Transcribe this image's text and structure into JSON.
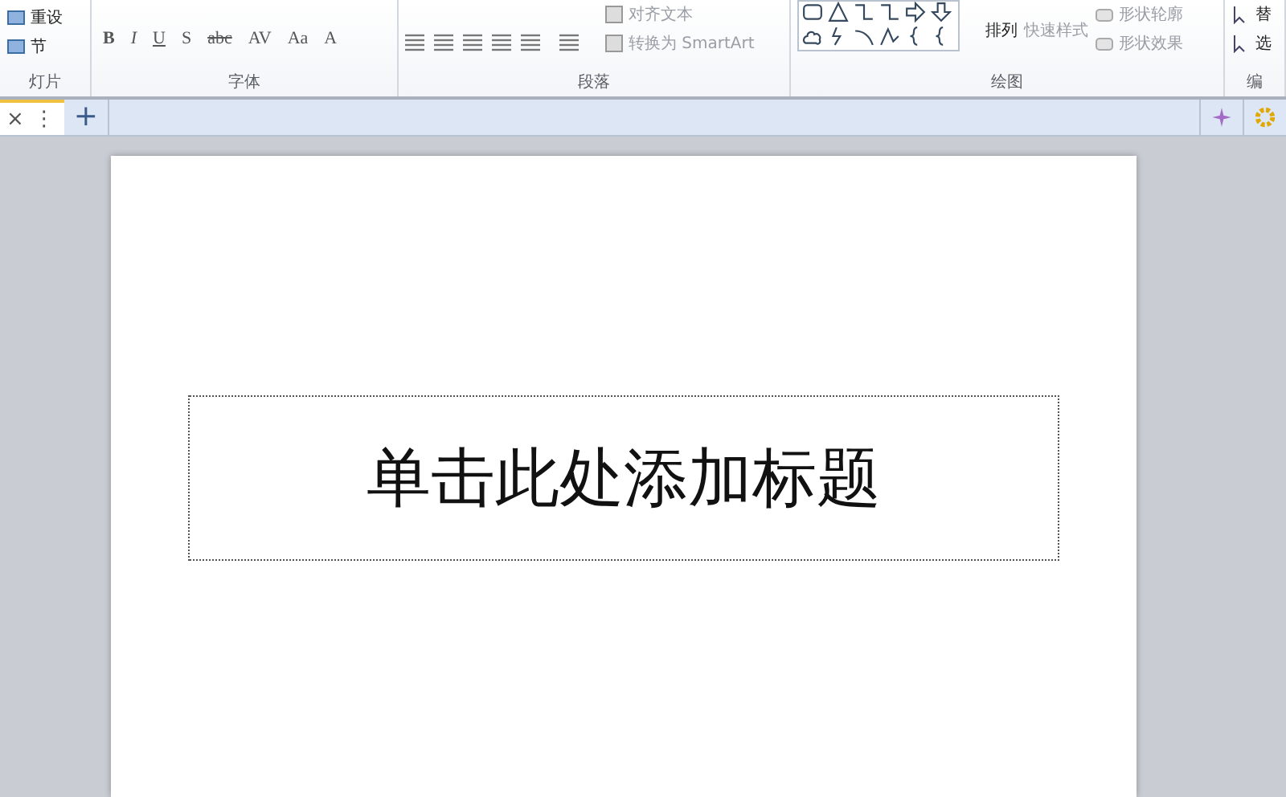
{
  "ribbon": {
    "groups": [
      {
        "kind": "slides",
        "label": "灯片",
        "items": [
          "重设",
          "节"
        ]
      },
      {
        "kind": "font",
        "label": "字体",
        "buttons": [
          "B",
          "I",
          "U",
          "S",
          "abc",
          "AV",
          "Aa",
          "A"
        ]
      },
      {
        "kind": "paragraph",
        "label": "段落",
        "items": [
          "对齐文本",
          "转换为 SmartArt"
        ]
      },
      {
        "kind": "drawing",
        "label": "绘图",
        "items": [
          "排列",
          "快速样式",
          "形状轮廓",
          "形状效果"
        ]
      },
      {
        "kind": "editing",
        "label": "编",
        "items": [
          "替",
          "选"
        ]
      }
    ]
  },
  "tab_bar": {
    "close": "×",
    "more": "⋮",
    "add": "+"
  },
  "slide": {
    "title_placeholder": "单击此处添加标题"
  }
}
